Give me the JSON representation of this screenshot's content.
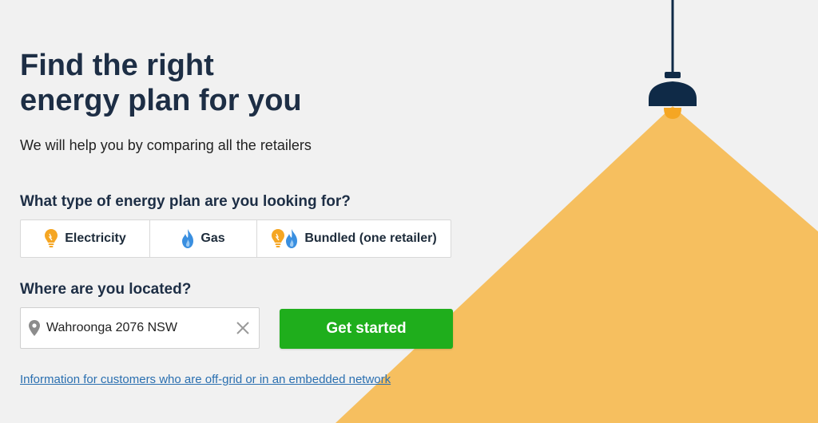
{
  "hero": {
    "title_line1": "Find the right",
    "title_line2": "energy plan for you",
    "subtitle": "We will help you by comparing all the retailers"
  },
  "plan_type": {
    "question": "What type of energy plan are you looking for?",
    "options": [
      {
        "label": "Electricity",
        "icon": "bulb-icon"
      },
      {
        "label": "Gas",
        "icon": "flame-icon"
      },
      {
        "label": "Bundled (one retailer)",
        "icon": "bulb-flame-icon"
      }
    ]
  },
  "location": {
    "question": "Where are you located?",
    "value": "Wahroonga 2076 NSW",
    "icon": "map-pin-icon",
    "clear_icon": "close-icon"
  },
  "cta": {
    "label": "Get started"
  },
  "info_link": {
    "label": "Information for customers who are off-grid or in an embedded network"
  },
  "colors": {
    "background": "#f1f1f1",
    "heading": "#1d2e45",
    "light_beam": "#f6bf5f",
    "lamp": "#0f2a47",
    "bulb": "#f5a623",
    "cta": "#1fae1c",
    "link": "#2a6fb0",
    "gas_blue": "#3a8fe0"
  }
}
